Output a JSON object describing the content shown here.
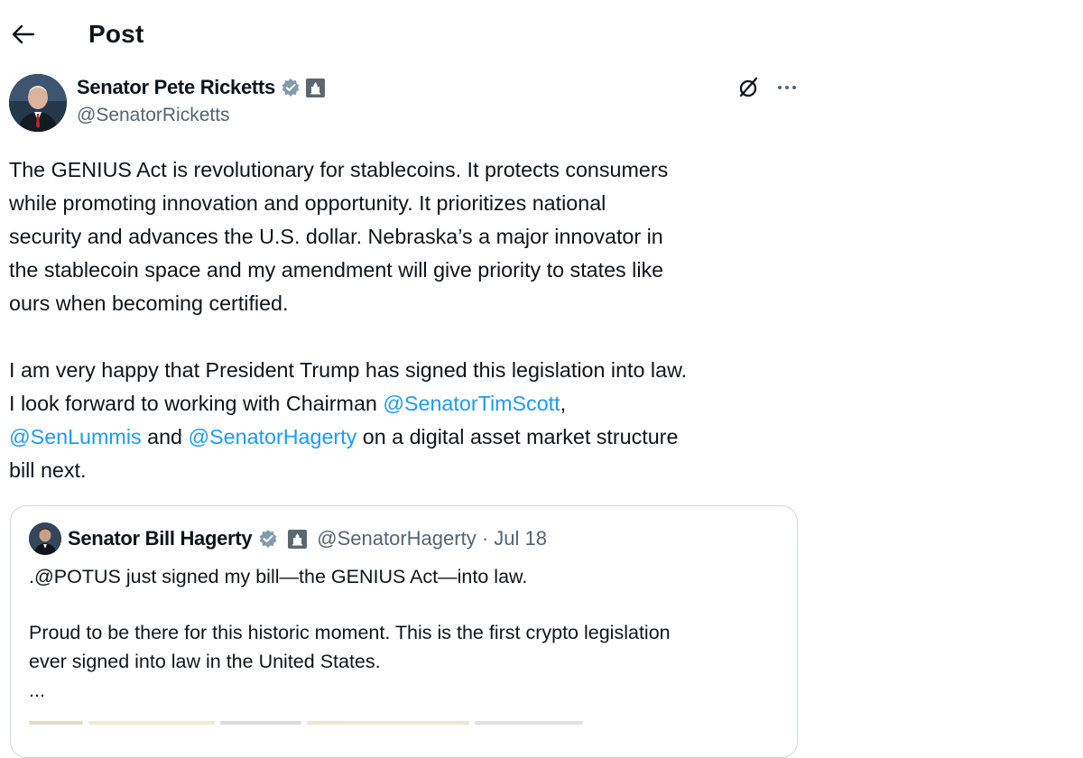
{
  "header": {
    "title": "Post",
    "back_icon": "arrow-left-icon"
  },
  "author": {
    "name": "Senator Pete Ricketts",
    "handle": "@SenatorRicketts",
    "verified_icon": "verified-badge-icon",
    "affiliation_icon": "government-badge-icon"
  },
  "actions": {
    "grok_icon": "grok-icon",
    "more_icon": "more-options-icon"
  },
  "post": {
    "lines_p1": [
      "The GENIUS Act is revolutionary for stablecoins. It protects consumers",
      "while promoting innovation and opportunity. It prioritizes national",
      "security and advances the U.S. dollar. Nebraska’s a major innovator in",
      "the stablecoin space and my amendment will give priority to states like",
      "ours when becoming certified."
    ],
    "p2_line1": "I am very happy that President Trump has signed this legislation into law.",
    "p2_line2_prefix": "I look forward to working with Chairman ",
    "mention_scott": "@SenatorTimScott",
    "p2_line2_suffix": ",",
    "mention_lummis": "@SenLummis",
    "p2_line3_and": " and ",
    "mention_hagerty": "@SenatorHagerty",
    "p2_line3_suffix": " on a digital asset market structure",
    "p2_line4": "bill next."
  },
  "quote": {
    "name": "Senator Bill Hagerty",
    "handle_date": "@SenatorHagerty · Jul 18",
    "line1": ".@POTUS just signed my bill—the GENIUS Act—into law.",
    "line2": "Proud to be there for this historic moment. This is the first crypto legislation",
    "line3": "ever signed into law in the United States.",
    "line4": "..."
  },
  "colors": {
    "text": "#0f1419",
    "secondary": "#536471",
    "link": "#1d9bf0",
    "verified": "#829aab",
    "border": "#cfd9de"
  }
}
